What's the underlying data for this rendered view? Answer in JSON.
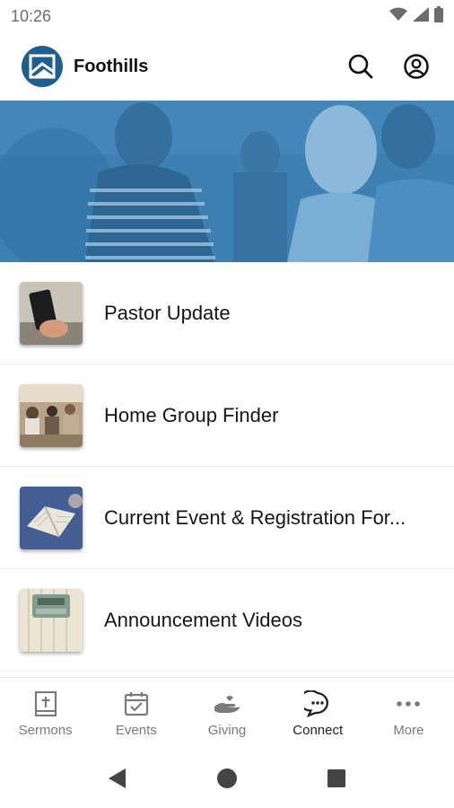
{
  "status_bar": {
    "time": "10:26",
    "icons": [
      "wifi-icon",
      "signal-icon",
      "battery-icon"
    ]
  },
  "app_bar": {
    "title": "Foothills",
    "logo_icon": "mountain-logo-icon",
    "actions": [
      "search-icon",
      "account-icon"
    ]
  },
  "colors": {
    "brand": "#1f5e8f",
    "hero_tint": "#3d7fb3",
    "active_nav": "#222222",
    "inactive_nav": "#7a7a7a"
  },
  "menu": {
    "items": [
      {
        "label": "Pastor Update",
        "thumbnail": "phone-photo"
      },
      {
        "label": "Home Group Finder",
        "thumbnail": "group-photo"
      },
      {
        "label": "Current Event & Registration For...",
        "thumbnail": "book-photo"
      },
      {
        "label": "Announcement Videos",
        "thumbnail": "typewriter-photo"
      }
    ]
  },
  "bottom_nav": {
    "items": [
      {
        "label": "Sermons",
        "icon": "bible-icon",
        "active": false
      },
      {
        "label": "Events",
        "icon": "calendar-check-icon",
        "active": false
      },
      {
        "label": "Giving",
        "icon": "giving-hand-icon",
        "active": false
      },
      {
        "label": "Connect",
        "icon": "chat-bubble-icon",
        "active": true
      },
      {
        "label": "More",
        "icon": "more-dots-icon",
        "active": false
      }
    ]
  },
  "system_nav": [
    "back-icon",
    "home-icon",
    "recents-icon"
  ]
}
